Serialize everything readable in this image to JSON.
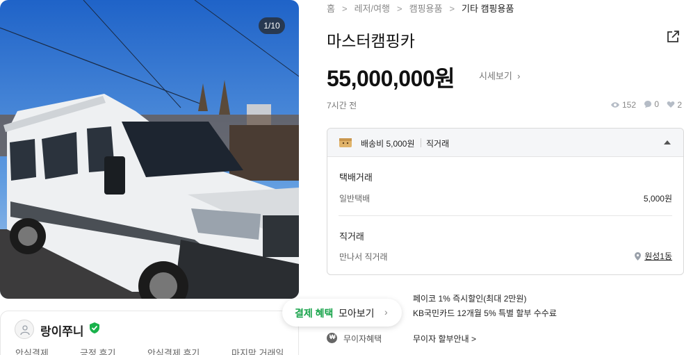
{
  "photo": {
    "counter": "1/10"
  },
  "seller": {
    "name": "랑이쭈니",
    "stats": [
      "안심결제",
      "긍정 후기",
      "안심결제 후기",
      "마지막 거래일"
    ]
  },
  "breadcrumb": [
    "홈",
    "레저/여행",
    "캠핑용품",
    "기타 캠핑용품"
  ],
  "product": {
    "title": "마스터캠핑카",
    "price": "55,000,000원",
    "price_link": "시세보기",
    "time": "7시간 전",
    "views": "152",
    "chats": "0",
    "likes": "2"
  },
  "delivery": {
    "fee": "배송비 5,000원",
    "direct": "직거래",
    "parcel_title": "택배거래",
    "parcel_label": "일반택배",
    "parcel_value": "5,000원",
    "direct_title": "직거래",
    "direct_label": "만나서 직거래",
    "direct_location": "원성1동"
  },
  "benefits": {
    "pill_green": "결제 혜택",
    "pill_text": "모아보기",
    "promo1": "페이코 1% 즉시할인(최대 2만원)",
    "promo2": "KB국민카드 12개월 5% 특별 할부 수수료",
    "nointerest_label": "무이자혜택",
    "nointerest_link": "무이자 할부안내 >"
  }
}
